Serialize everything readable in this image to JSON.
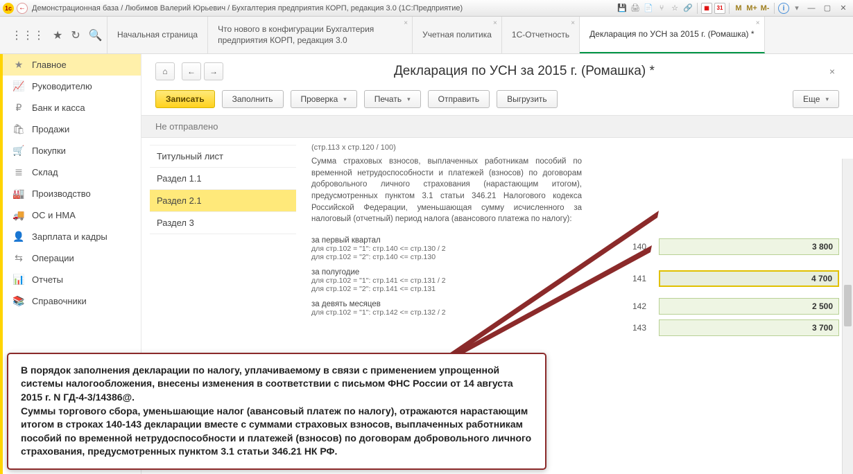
{
  "titlebar": {
    "title": "Демонстрационная база / Любимов Валерий Юрьевич / Бухгалтерия предприятия КОРП, редакция 3.0  (1С:Предприятие)",
    "m_icons": [
      "M",
      "M+",
      "M-"
    ]
  },
  "tabs": [
    {
      "label": "Начальная страница",
      "closable": false
    },
    {
      "label": "Что нового в конфигурации Бухгалтерия предприятия КОРП, редакция 3.0",
      "closable": true
    },
    {
      "label": "Учетная политика",
      "closable": true
    },
    {
      "label": "1С-Отчетность",
      "closable": true
    },
    {
      "label": "Декларация по УСН за 2015 г. (Ромашка) *",
      "closable": true,
      "active": true
    }
  ],
  "sidebar": [
    {
      "icon": "★",
      "label": "Главное",
      "active": true
    },
    {
      "icon": "📈",
      "label": "Руководителю"
    },
    {
      "icon": "₽",
      "label": "Банк и касса"
    },
    {
      "icon": "🛍",
      "label": "Продажи"
    },
    {
      "icon": "🛒",
      "label": "Покупки"
    },
    {
      "icon": "≣",
      "label": "Склад"
    },
    {
      "icon": "🏭",
      "label": "Производство"
    },
    {
      "icon": "🚚",
      "label": "ОС и НМА"
    },
    {
      "icon": "👤",
      "label": "Зарплата и кадры"
    },
    {
      "icon": "⇆",
      "label": "Операции"
    },
    {
      "icon": "📊",
      "label": "Отчеты"
    },
    {
      "icon": "📚",
      "label": "Справочники"
    }
  ],
  "page": {
    "title": "Декларация по УСН за 2015 г. (Ромашка) *",
    "status": "Не отправлено",
    "actions": {
      "save": "Записать",
      "fill": "Заполнить",
      "check": "Проверка",
      "print": "Печать",
      "send": "Отправить",
      "upload": "Выгрузить",
      "more": "Еще"
    }
  },
  "sections": [
    {
      "label": "Титульный лист"
    },
    {
      "label": "Раздел 1.1"
    },
    {
      "label": "Раздел 2.1",
      "active": true
    },
    {
      "label": "Раздел 3"
    }
  ],
  "form": {
    "formula": "(стр.113 x стр.120 / 100)",
    "desc": "Сумма страховых взносов, выплаченных работникам пособий по временной нетрудоспособности и платежей (взносов) по договорам добровольного личного страхования (нарастающим итогом), предусмотренных пунктом 3.1 статьи 346.21 Налогового кодекса Российской Федерации, уменьшающая сумму исчисленного за налоговый (отчетный) период налога (авансового платежа по налогу):",
    "rows": [
      {
        "title": "за первый квартал",
        "sub1": "для стр.102 = \"1\": стр.140 <= стр.130 / 2",
        "sub2": "для стр.102 = \"2\": стр.140 <= стр.130",
        "code": "140",
        "val": "3 800"
      },
      {
        "title": "за полугодие",
        "sub1": "для стр.102 = \"1\": стр.141 <= стр.131 / 2",
        "sub2": "для стр.102 = \"2\": стр.141 <= стр.131",
        "code": "141",
        "val": "4 700",
        "hl": true
      },
      {
        "title": "за девять месяцев",
        "sub1": "для стр.102 = \"1\": стр.142 <= стр.132 / 2",
        "sub2": "",
        "code": "142",
        "val": "2 500"
      },
      {
        "title": "",
        "sub1": "",
        "sub2": "",
        "code": "143",
        "val": "3 700"
      }
    ]
  },
  "callout": {
    "text": "В порядок заполнения декларации по налогу, уплачиваемому в связи с применением упрощенной системы налогообложения, внесены изменения в соответствии с письмом ФНС России от 14 августа 2015 г. N ГД-4-3/14386@.\nСуммы торгового сбора, уменьшающие налог (авансовый платеж по налогу), отражаются нарастающим итогом в строках 140-143 декларации вместе с суммами страховых взносов, выплаченных работникам пособий по временной нетрудоспособности и платежей (взносов) по договорам добровольного личного страхования, предусмотренных пунктом 3.1 статьи 346.21 НК РФ."
  }
}
